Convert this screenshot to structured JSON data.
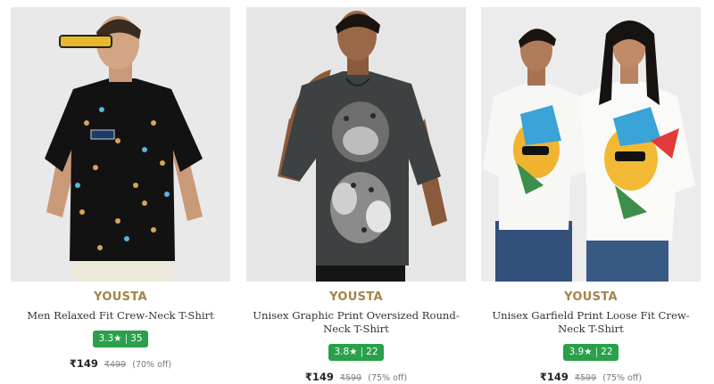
{
  "products": [
    {
      "brand": "YOUSTA",
      "title": "Men Relaxed Fit Crew-Neck T-Shirt",
      "rating": "3.3★",
      "reviews": "35",
      "price": "₹149",
      "mrp": "₹499",
      "discount": "(70% off)"
    },
    {
      "brand": "YOUSTA",
      "title": "Unisex Graphic Print Oversized Round-Neck T-Shirt",
      "rating": "3.8★",
      "reviews": "22",
      "price": "₹149",
      "mrp": "₹599",
      "discount": "(75% off)"
    },
    {
      "brand": "YOUSTA",
      "title": "Unisex Garfield Print Loose Fit Crew-Neck T-Shirt",
      "rating": "3.9★",
      "reviews": "22",
      "price": "₹149",
      "mrp": "₹599",
      "discount": "(75% off)"
    }
  ],
  "colors": {
    "brand": "#a5824a",
    "rating_bg": "#2aa04a",
    "image_bg": "#ebebeb"
  }
}
